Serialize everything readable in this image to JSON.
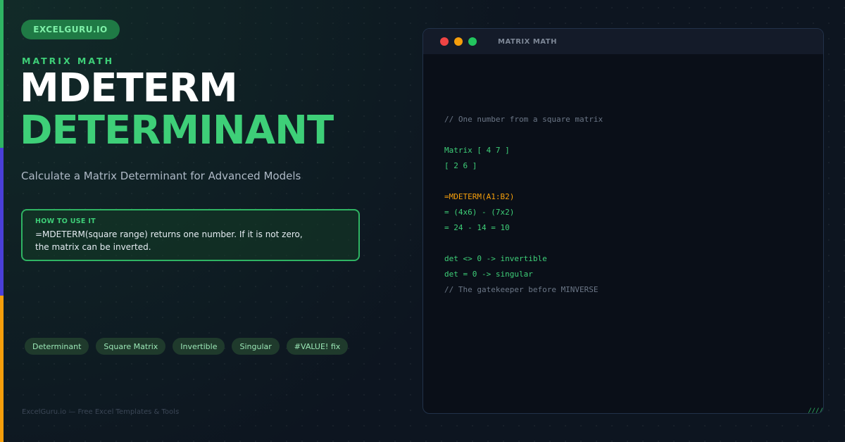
{
  "brand": {
    "pill": "EXCELGURU.IO"
  },
  "hero": {
    "eyebrow": "MATRIX MATH",
    "title": "MDETERM",
    "title_highlight": "DETERMINANT",
    "subtitle": "Calculate a Matrix Determinant for Advanced Models"
  },
  "howto": {
    "label": "HOW TO USE IT",
    "text": "=MDETERM(square range) returns one number. If it is not zero, the matrix can be inverted."
  },
  "tags": [
    "Determinant",
    "Square Matrix",
    "Invertible",
    "Singular",
    "#VALUE! fix"
  ],
  "footer": "ExcelGuru.io — Free Excel Templates & Tools",
  "terminal": {
    "title": "MATRIX MATH",
    "mark": "////",
    "lines": [
      {
        "text": "// One number from a square matrix",
        "style": "comment"
      },
      {
        "text": "",
        "style": "blank"
      },
      {
        "text": "Matrix [ 4 7 ]",
        "style": "green"
      },
      {
        "text": "[ 2 6 ]",
        "style": "green"
      },
      {
        "text": "",
        "style": "blank"
      },
      {
        "text": "=MDETERM(A1:B2)",
        "style": "orange"
      },
      {
        "text": "= (4x6) - (7x2)",
        "style": "green"
      },
      {
        "text": "= 24 - 14 = 10",
        "style": "green"
      },
      {
        "text": "",
        "style": "blank"
      },
      {
        "text": "det <> 0 -> invertible",
        "style": "green"
      },
      {
        "text": "det = 0 -> singular",
        "style": "green"
      },
      {
        "text": "// The gatekeeper before MINVERSE",
        "style": "comment"
      }
    ]
  },
  "colors": {
    "accent_green": "#3ecf78",
    "accent_indigo": "#4a3fd8",
    "accent_orange": "#f59e0b",
    "background": "#0d1520"
  }
}
